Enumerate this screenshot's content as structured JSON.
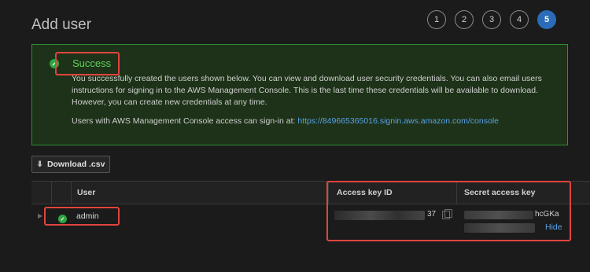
{
  "page": {
    "title": "Add user"
  },
  "steps": [
    "1",
    "2",
    "3",
    "4",
    "5"
  ],
  "active_step": "5",
  "alert": {
    "title": "Success",
    "message": "You successfully created the users shown below. You can view and download user security credentials. You can also email users instructions for signing in to the AWS Management Console. This is the last time these credentials will be available to download. However, you can create new credentials at any time.",
    "signin_prefix": "Users with AWS Management Console access can sign-in at: ",
    "signin_url": "https://849665365016.signin.aws.amazon.com/console"
  },
  "download_label": "Download .csv",
  "table": {
    "headers": {
      "user": "User",
      "access_key_id": "Access key ID",
      "secret_access_key": "Secret access key"
    },
    "rows": [
      {
        "user": "admin",
        "access_key_tail": "37",
        "secret_tail": "hcGKa",
        "hide_label": "Hide"
      }
    ]
  },
  "colors": {
    "success": "#5fd35b",
    "highlight": "#e0443f",
    "link": "#5aa0e6",
    "active_step": "#2b6cb8"
  }
}
